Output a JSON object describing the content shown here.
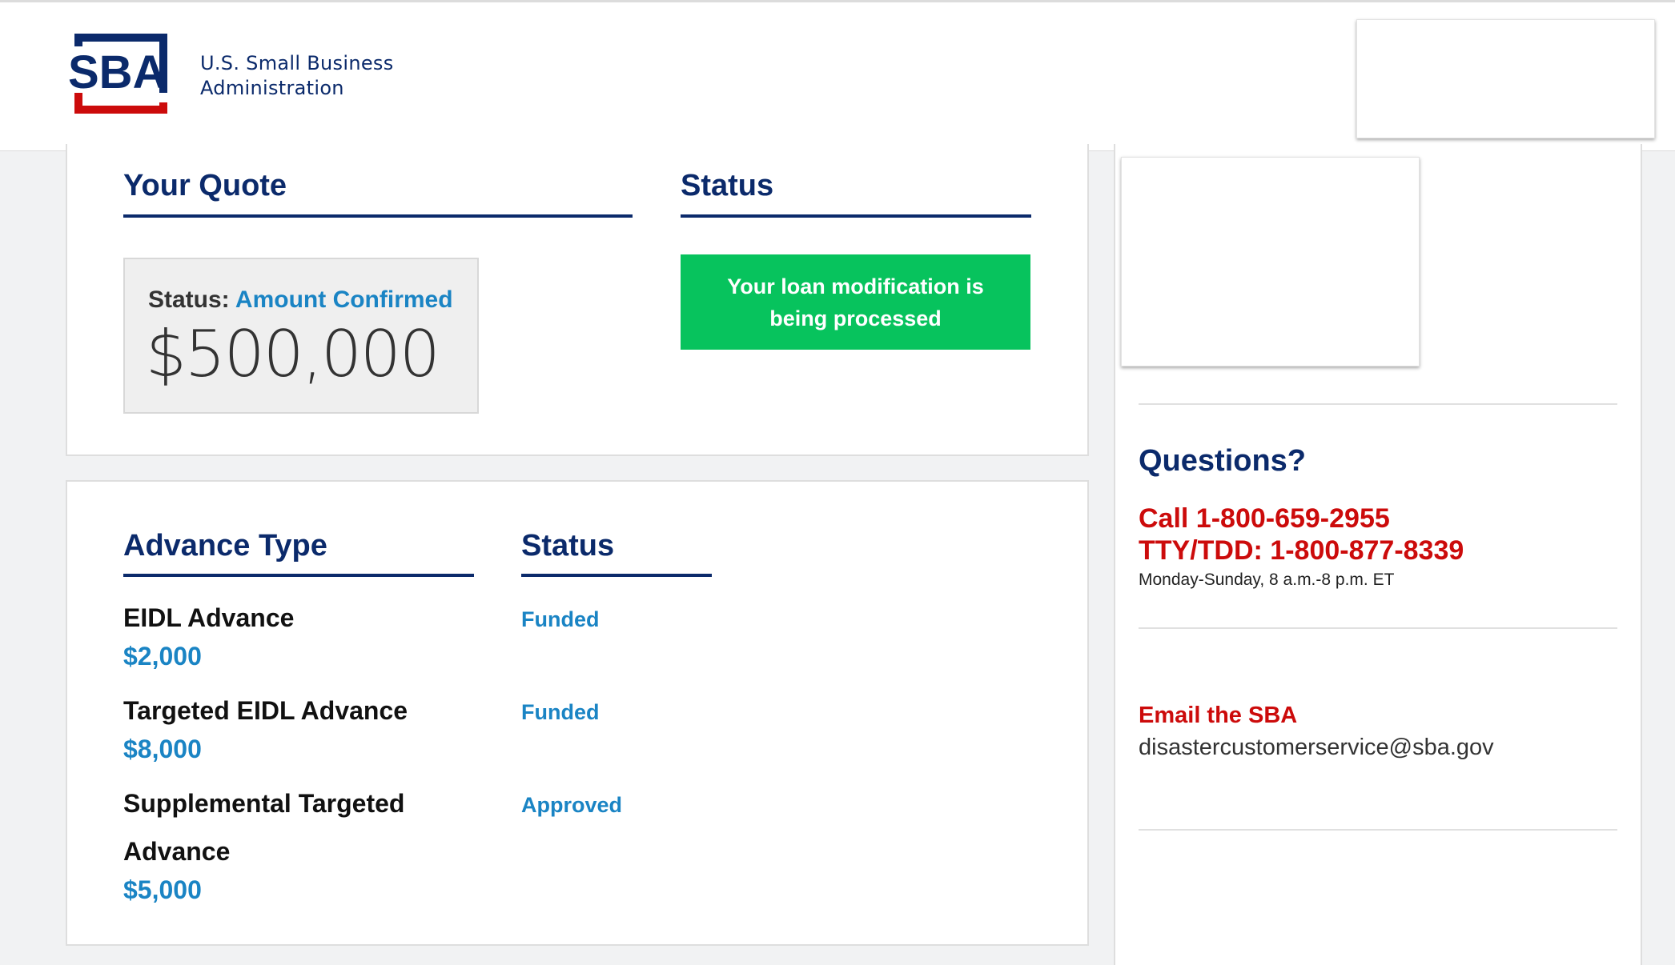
{
  "header": {
    "logo_letters": "SBA",
    "org_line1": "U.S. Small Business",
    "org_line2": "Administration"
  },
  "quote": {
    "heading": "Your Quote",
    "status_label": "Status:",
    "status_value": "Amount Confirmed",
    "amount": "$500,000"
  },
  "status": {
    "heading": "Status",
    "banner": "Your loan modification is being processed"
  },
  "advances": {
    "type_heading": "Advance Type",
    "status_heading": "Status",
    "items": [
      {
        "name": "EIDL Advance",
        "amount": "$2,000",
        "status": "Funded"
      },
      {
        "name": "Targeted EIDL Advance",
        "amount": "$8,000",
        "status": "Funded"
      },
      {
        "name_line1": "Supplemental Targeted",
        "name_line2": "Advance",
        "amount": "$5,000",
        "status": "Approved"
      }
    ]
  },
  "sidebar": {
    "questions_heading": "Questions?",
    "call": "Call 1-800-659-2955",
    "tty": "TTY/TDD: 1-800-877-8339",
    "hours": "Monday-Sunday, 8 a.m.-8 p.m. ET",
    "email_title": "Email the SBA",
    "email_address": "disastercustomerservice@sba.gov"
  },
  "colors": {
    "navy": "#0b2a6b",
    "link_blue": "#1a84c4",
    "success_green": "#07c35d",
    "alert_red": "#cc0b0b"
  }
}
